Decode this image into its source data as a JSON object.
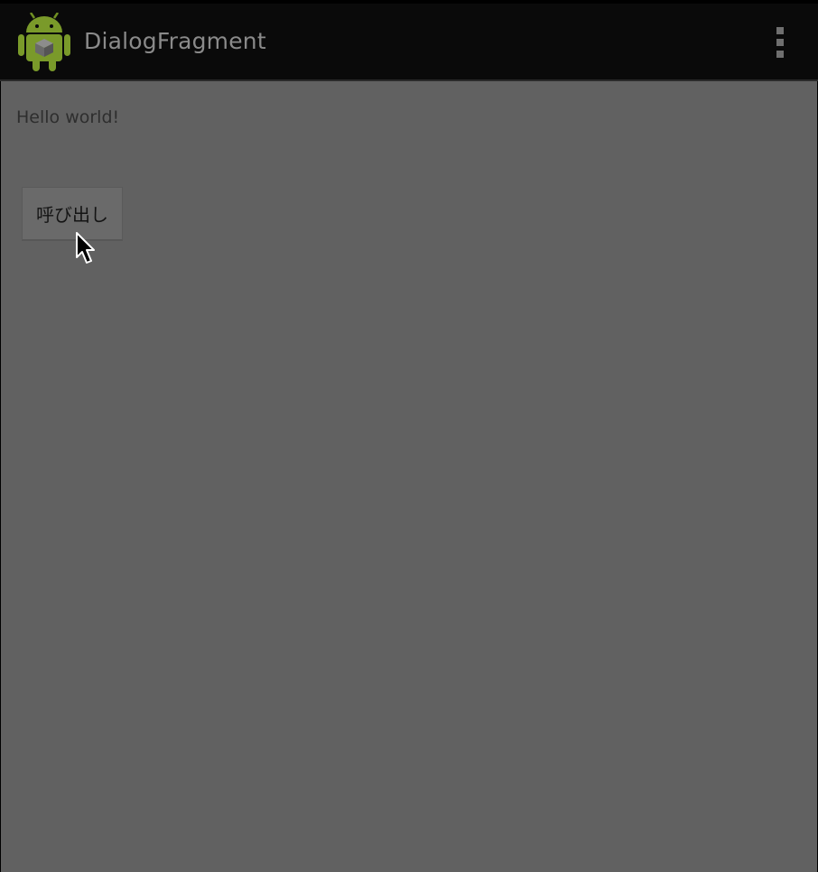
{
  "action_bar": {
    "title": "DialogFragment",
    "app_icon": "android-robot-icon",
    "overflow_icon": "overflow-menu-icon"
  },
  "main": {
    "hello_text": "Hello world!",
    "call_button_label": "呼び出し"
  },
  "colors": {
    "action_bar_bg": "#0a0a0a",
    "content_bg": "#616161",
    "android_green": "#7a9a2a"
  }
}
